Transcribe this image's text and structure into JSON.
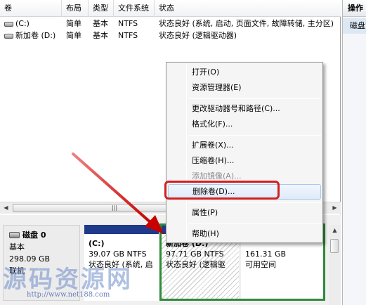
{
  "volume_list": {
    "columns": [
      "卷",
      "布局",
      "类型",
      "文件系统",
      "状态"
    ],
    "rows": [
      {
        "volume": "(C:)",
        "layout": "简单",
        "type": "基本",
        "fs": "NTFS",
        "status": "状态良好 (系统, 启动, 页面文件, 故障转储, 主分区)"
      },
      {
        "volume": "新加卷 (D:)",
        "layout": "简单",
        "type": "基本",
        "fs": "NTFS",
        "status": "状态良好 (逻辑驱动器)"
      }
    ],
    "scroll_thumb_glyph": "|||"
  },
  "actions_pane": {
    "title": "操作",
    "item": "磁盘管理"
  },
  "disk": {
    "name": "磁盘 0",
    "type": "基本",
    "size": "298.09 GB",
    "status": "联机",
    "partitions": [
      {
        "name": "(C:)",
        "size_fs": "39.07 GB NTFS",
        "status": "状态良好 (系统, 启"
      },
      {
        "name": "新加卷 (D:)",
        "size_fs": "97.71 GB NTFS",
        "status": "状态良好 (逻辑驱"
      },
      {
        "name": "",
        "size_fs": "161.31 GB",
        "status": "可用空间"
      }
    ]
  },
  "context_menu": {
    "open": "打开(O)",
    "explorer": "资源管理器(E)",
    "change_letter": "更改驱动器号和路径(C)...",
    "format": "格式化(F)...",
    "extend": "扩展卷(X)...",
    "shrink": "压缩卷(H)...",
    "add_mirror": "添加镜像(A)...",
    "delete": "删除卷(D)...",
    "properties": "属性(P)",
    "help": "帮助(H)"
  },
  "watermark": {
    "text": "源码资源网",
    "url": "http://www.net188.com"
  },
  "colors": {
    "primary_partition_bar": "#1f3a8a",
    "unallocated_bar": "#1a1a1a",
    "selection_border": "#2e8b3a",
    "annotation_red": "#d21f1f"
  }
}
